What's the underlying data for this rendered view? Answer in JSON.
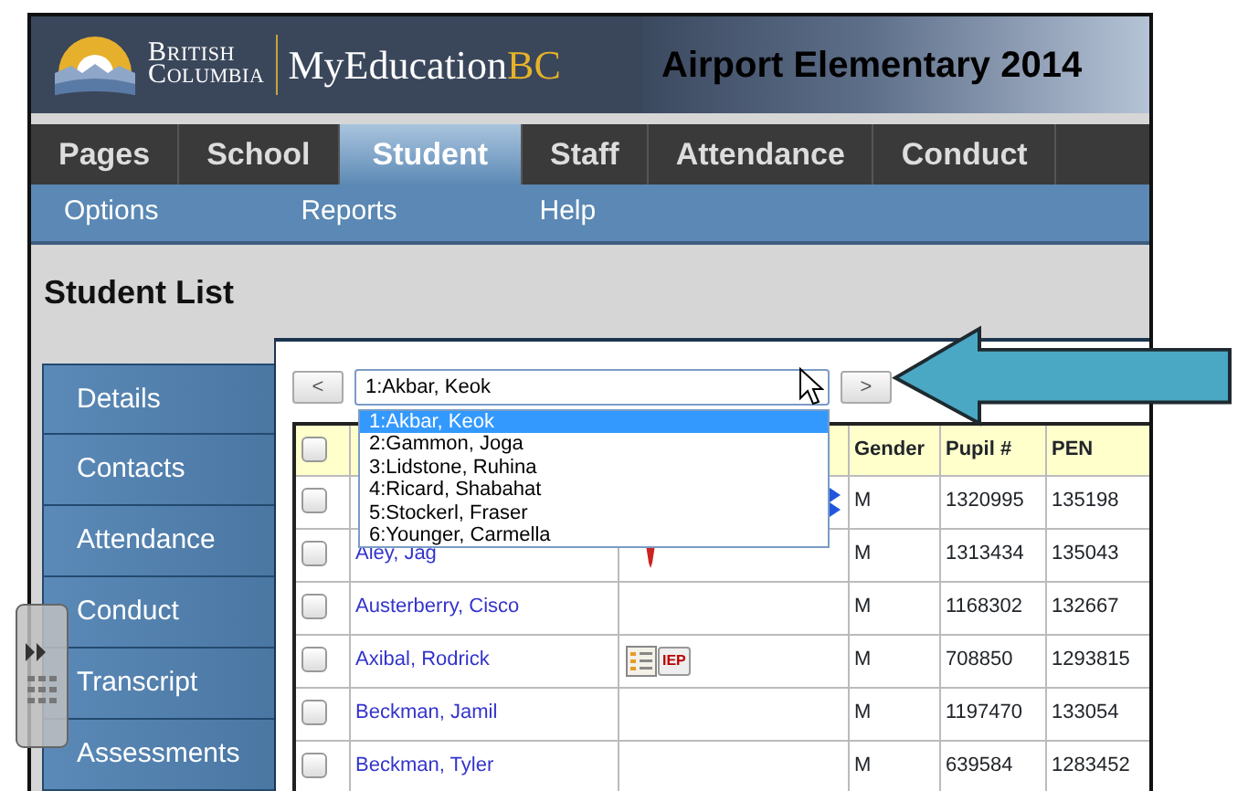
{
  "header": {
    "logo_top": "BRITISH",
    "logo_bottom": "COLUMBIA",
    "brand": "MyEducation",
    "brand_accent": "BC",
    "title": "Airport Elementary 2014"
  },
  "tabs": [
    {
      "label": "Pages",
      "selected": false
    },
    {
      "label": "School",
      "selected": false
    },
    {
      "label": "Student",
      "selected": true
    },
    {
      "label": "Staff",
      "selected": false
    },
    {
      "label": "Attendance",
      "selected": false
    },
    {
      "label": "Conduct",
      "selected": false
    }
  ],
  "submenu": [
    "Options",
    "Reports",
    "Help"
  ],
  "page_title": "Student List",
  "sidebar": [
    "Details",
    "Contacts",
    "Attendance",
    "Conduct",
    "Transcript",
    "Assessments"
  ],
  "navigator": {
    "prev": "<",
    "next": ">",
    "value": "1:Akbar, Keok",
    "options": [
      {
        "label": "1:Akbar, Keok",
        "selected": true
      },
      {
        "label": "2:Gammon, Joga",
        "selected": false
      },
      {
        "label": "3:Lidstone, Ruhina",
        "selected": false
      },
      {
        "label": "4:Ricard, Shabahat",
        "selected": false
      },
      {
        "label": "5:Stockerl, Fraser",
        "selected": false
      },
      {
        "label": "6:Younger, Carmella",
        "selected": false
      }
    ]
  },
  "table": {
    "select_all": {
      "checked": false
    },
    "columns": [
      "",
      "",
      "",
      "Gender",
      "Pupil #",
      "PEN"
    ],
    "rows": [
      {
        "checked": false,
        "name": "",
        "icons": [
          {
            "kind": "arrows"
          }
        ],
        "gender": "M",
        "pupil": "1320995",
        "pen": "135198"
      },
      {
        "checked": false,
        "name": "Aley, Jag",
        "icons": [
          {
            "kind": "alert"
          }
        ],
        "gender": "M",
        "pupil": "1313434",
        "pen": "135043"
      },
      {
        "checked": false,
        "name": "Austerberry, Cisco",
        "icons": [],
        "gender": "M",
        "pupil": "1168302",
        "pen": "132667"
      },
      {
        "checked": false,
        "name": "Axibal, Rodrick",
        "icons": [
          {
            "kind": "document"
          },
          {
            "kind": "iep"
          }
        ],
        "iep_label": "IEP",
        "gender": "M",
        "pupil": "708850",
        "pen": "1293815"
      },
      {
        "checked": false,
        "name": "Beckman, Jamil",
        "icons": [],
        "gender": "M",
        "pupil": "1197470",
        "pen": "133054"
      },
      {
        "checked": false,
        "name": "Beckman, Tyler",
        "icons": [],
        "gender": "M",
        "pupil": "639584",
        "pen": "1283452"
      }
    ]
  }
}
